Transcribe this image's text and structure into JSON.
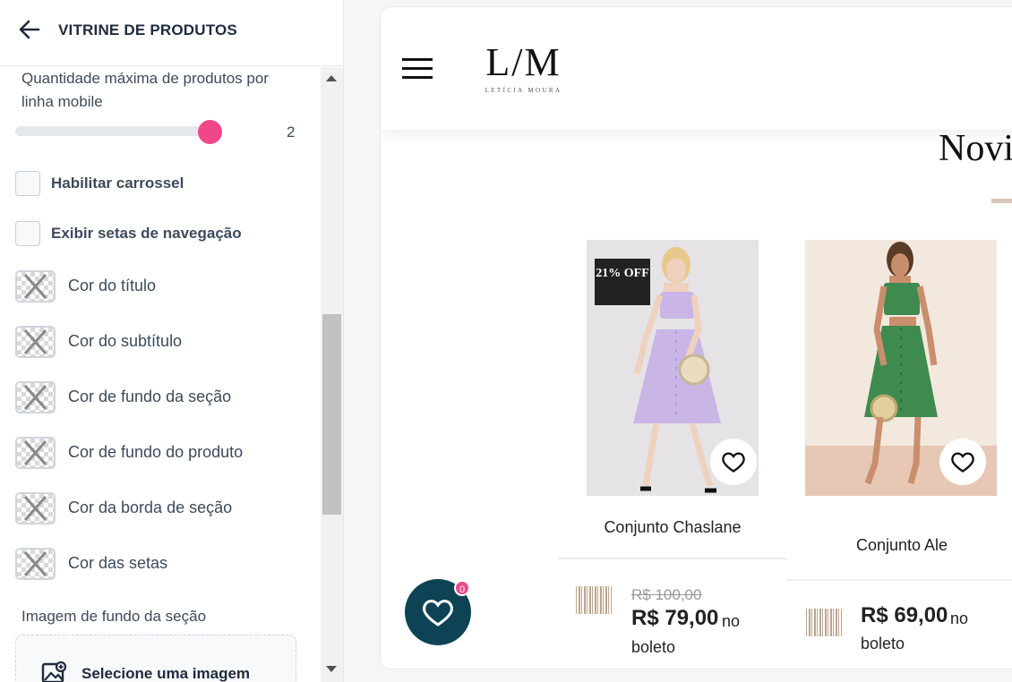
{
  "sidebar": {
    "title": "VITRINE DE PRODUTOS",
    "qty_label": "Quantidade máxima de produtos por linha mobile",
    "qty_value": "2",
    "carousel_label": "Habilitar carrossel",
    "arrows_label": "Exibir setas de navegação",
    "colors": [
      "Cor do título",
      "Cor do subtítulo",
      "Cor de fundo da seção",
      "Cor de fundo do produto",
      "Cor da borda de seção",
      "Cor das setas"
    ],
    "bg_image_label": "Imagem de fundo da seção",
    "select_image_label": "Selecione uma imagem"
  },
  "preview": {
    "logo_mark": "L/M",
    "logo_sub": "LETÍCIA MOURA",
    "section_title": "Novi",
    "products": [
      {
        "name": "Conjunto Chaslane",
        "badge": "21% OFF",
        "old_price": "R$ 100,00",
        "price": "R$ 79,00",
        "price_suffix_1": "no",
        "price_suffix_2": "boleto"
      },
      {
        "name": "Conjunto Ale",
        "price": "R$ 69,00",
        "price_suffix_1": "no",
        "price_suffix_2": "boleto"
      }
    ],
    "wishlist_count": "0"
  },
  "colors": {
    "accent_pink": "#f0468a",
    "fav_button": "#0d4354",
    "lilac_dress": "#c9b5e6",
    "green_dress": "#3f8a4f"
  }
}
